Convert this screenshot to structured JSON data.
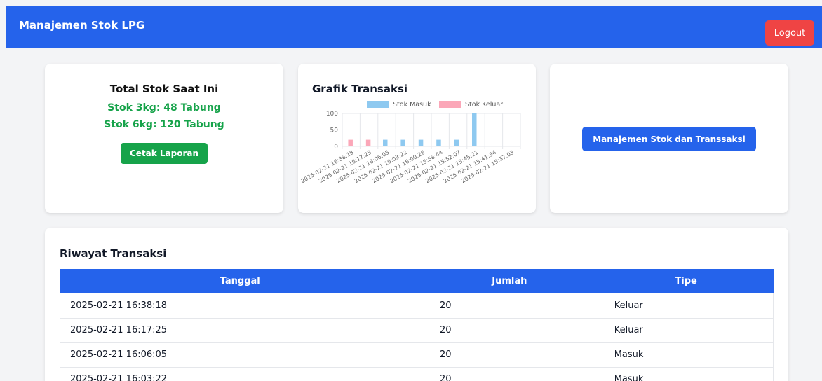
{
  "app": {
    "title": "Manajemen Stok LPG",
    "logout_label": "Logout"
  },
  "summary": {
    "title": "Total Stok Saat Ini",
    "stok_3kg": "Stok 3kg: 48 Tabung",
    "stok_6kg": "Stok 6kg: 120 Tabung",
    "print_label": "Cetak Laporan"
  },
  "chart_card": {
    "title": "Grafik Transaksi"
  },
  "manage": {
    "button_label": "Manajemen Stok dan Transsaksi"
  },
  "history": {
    "title": "Riwayat Transaksi",
    "columns": [
      "Tanggal",
      "Jumlah",
      "Tipe"
    ],
    "rows": [
      [
        "2025-02-21 16:38:18",
        "20",
        "Keluar"
      ],
      [
        "2025-02-21 16:17:25",
        "20",
        "Keluar"
      ],
      [
        "2025-02-21 16:06:05",
        "20",
        "Masuk"
      ],
      [
        "2025-02-21 16:03:22",
        "20",
        "Masuk"
      ]
    ]
  },
  "colors": {
    "primary": "#2563eb",
    "success": "#16a34a",
    "danger": "#ef4444",
    "masuk": "#8ec9f0",
    "keluar": "#fba7b8"
  },
  "chart_data": {
    "type": "bar",
    "categories": [
      "2025-02-21 16:38:18",
      "2025-02-21 16:17:25",
      "2025-02-21 16:06:05",
      "2025-02-21 16:03:22",
      "2025-02-21 16:00:26",
      "2025-02-21 15:58:44",
      "2025-02-21 15:52:07",
      "2025-02-21 15:45:21",
      "2025-02-21 15:41:34",
      "2025-02-21 15:37:03"
    ],
    "series": [
      {
        "name": "Stok Masuk",
        "color": "#8ec9f0",
        "values": [
          0,
          0,
          20,
          20,
          20,
          20,
          20,
          100,
          0,
          0
        ]
      },
      {
        "name": "Stok Keluar",
        "color": "#fba7b8",
        "values": [
          20,
          20,
          0,
          0,
          0,
          0,
          0,
          0,
          0,
          0
        ]
      }
    ],
    "yticks": [
      0,
      50,
      100
    ],
    "ylim": [
      0,
      100
    ],
    "legend": "top",
    "grid": true
  }
}
